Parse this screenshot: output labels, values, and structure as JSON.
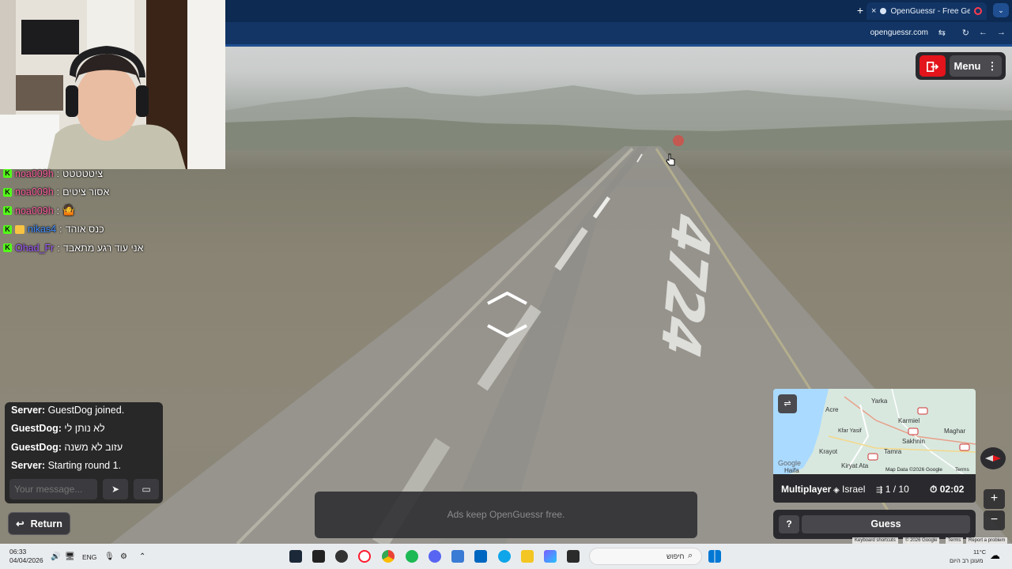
{
  "browser": {
    "tab_title": "OpenGuessr - Free GeoGue",
    "tab_close": "×",
    "new_tab": "+",
    "tab_menu": "⌄",
    "url": "openguessr.com"
  },
  "twitch_chat": [
    {
      "user": "noa009h",
      "user_color": "#ff5fa2",
      "text": "ציטטטטט",
      "badges": [
        "kick"
      ]
    },
    {
      "user": "noa009h",
      "user_color": "#ff5fa2",
      "text": "אסור ציטים",
      "badges": [
        "kick"
      ]
    },
    {
      "user": "noa009h",
      "user_color": "#ff5fa2",
      "text": "",
      "emoji": "🤷",
      "badges": [
        "kick"
      ]
    },
    {
      "user": "nikas4",
      "user_color": "#3f8cff",
      "text": "כנס אוהד",
      "badges": [
        "kick",
        "sub"
      ]
    },
    {
      "user": "Ohad_Fr",
      "user_color": "#a25cff",
      "text": "אני עוד רגע מתאבד",
      "badges": [
        "kick"
      ]
    }
  ],
  "game": {
    "menu_label": "Menu",
    "exit_icon": "exit-icon",
    "road_marking": "4724",
    "chat": {
      "lines": [
        {
          "sender": "Server:",
          "text": "GuestDog joined."
        },
        {
          "sender": "GuestDog:",
          "text": "לא נותן לי"
        },
        {
          "sender": "GuestDog:",
          "text": "עזוב לא משנה"
        },
        {
          "sender": "Server:",
          "text": "Starting round 1."
        }
      ],
      "input_placeholder": "Your message..."
    },
    "return_label": "Return",
    "ads_text": "Ads keep OpenGuessr free.",
    "minimap": {
      "labels": [
        "Yarka",
        "Acre",
        "Karmiel",
        "Maghar",
        "Sakhnin",
        "Kfar Yasif",
        "Tamra",
        "Krayot",
        "Kiryat Ata",
        "Haifa"
      ],
      "attribution": "Map Data ©2026 Google",
      "terms": "Terms",
      "google": "Google"
    },
    "mode": "Multiplayer",
    "country": "Israel",
    "round": "1 / 10",
    "timer": "02:02",
    "help_label": "?",
    "guess_label": "Guess",
    "zoom_in": "+",
    "zoom_out": "−",
    "google_footer": [
      "Keyboard shortcuts",
      "© 2026 Google",
      "Terms",
      "Report a problem"
    ]
  },
  "taskbar": {
    "time": "06:33",
    "date": "04/04/2026",
    "lang": "ENG",
    "search_placeholder": "חיפוש",
    "weather_temp": "11°C",
    "weather_desc": "מעונן רב היום"
  },
  "colors": {
    "browser_dark": "#0d2a52",
    "browser_mid": "#123565",
    "exit_red": "#e3141b",
    "kick_green": "#53fc18"
  }
}
